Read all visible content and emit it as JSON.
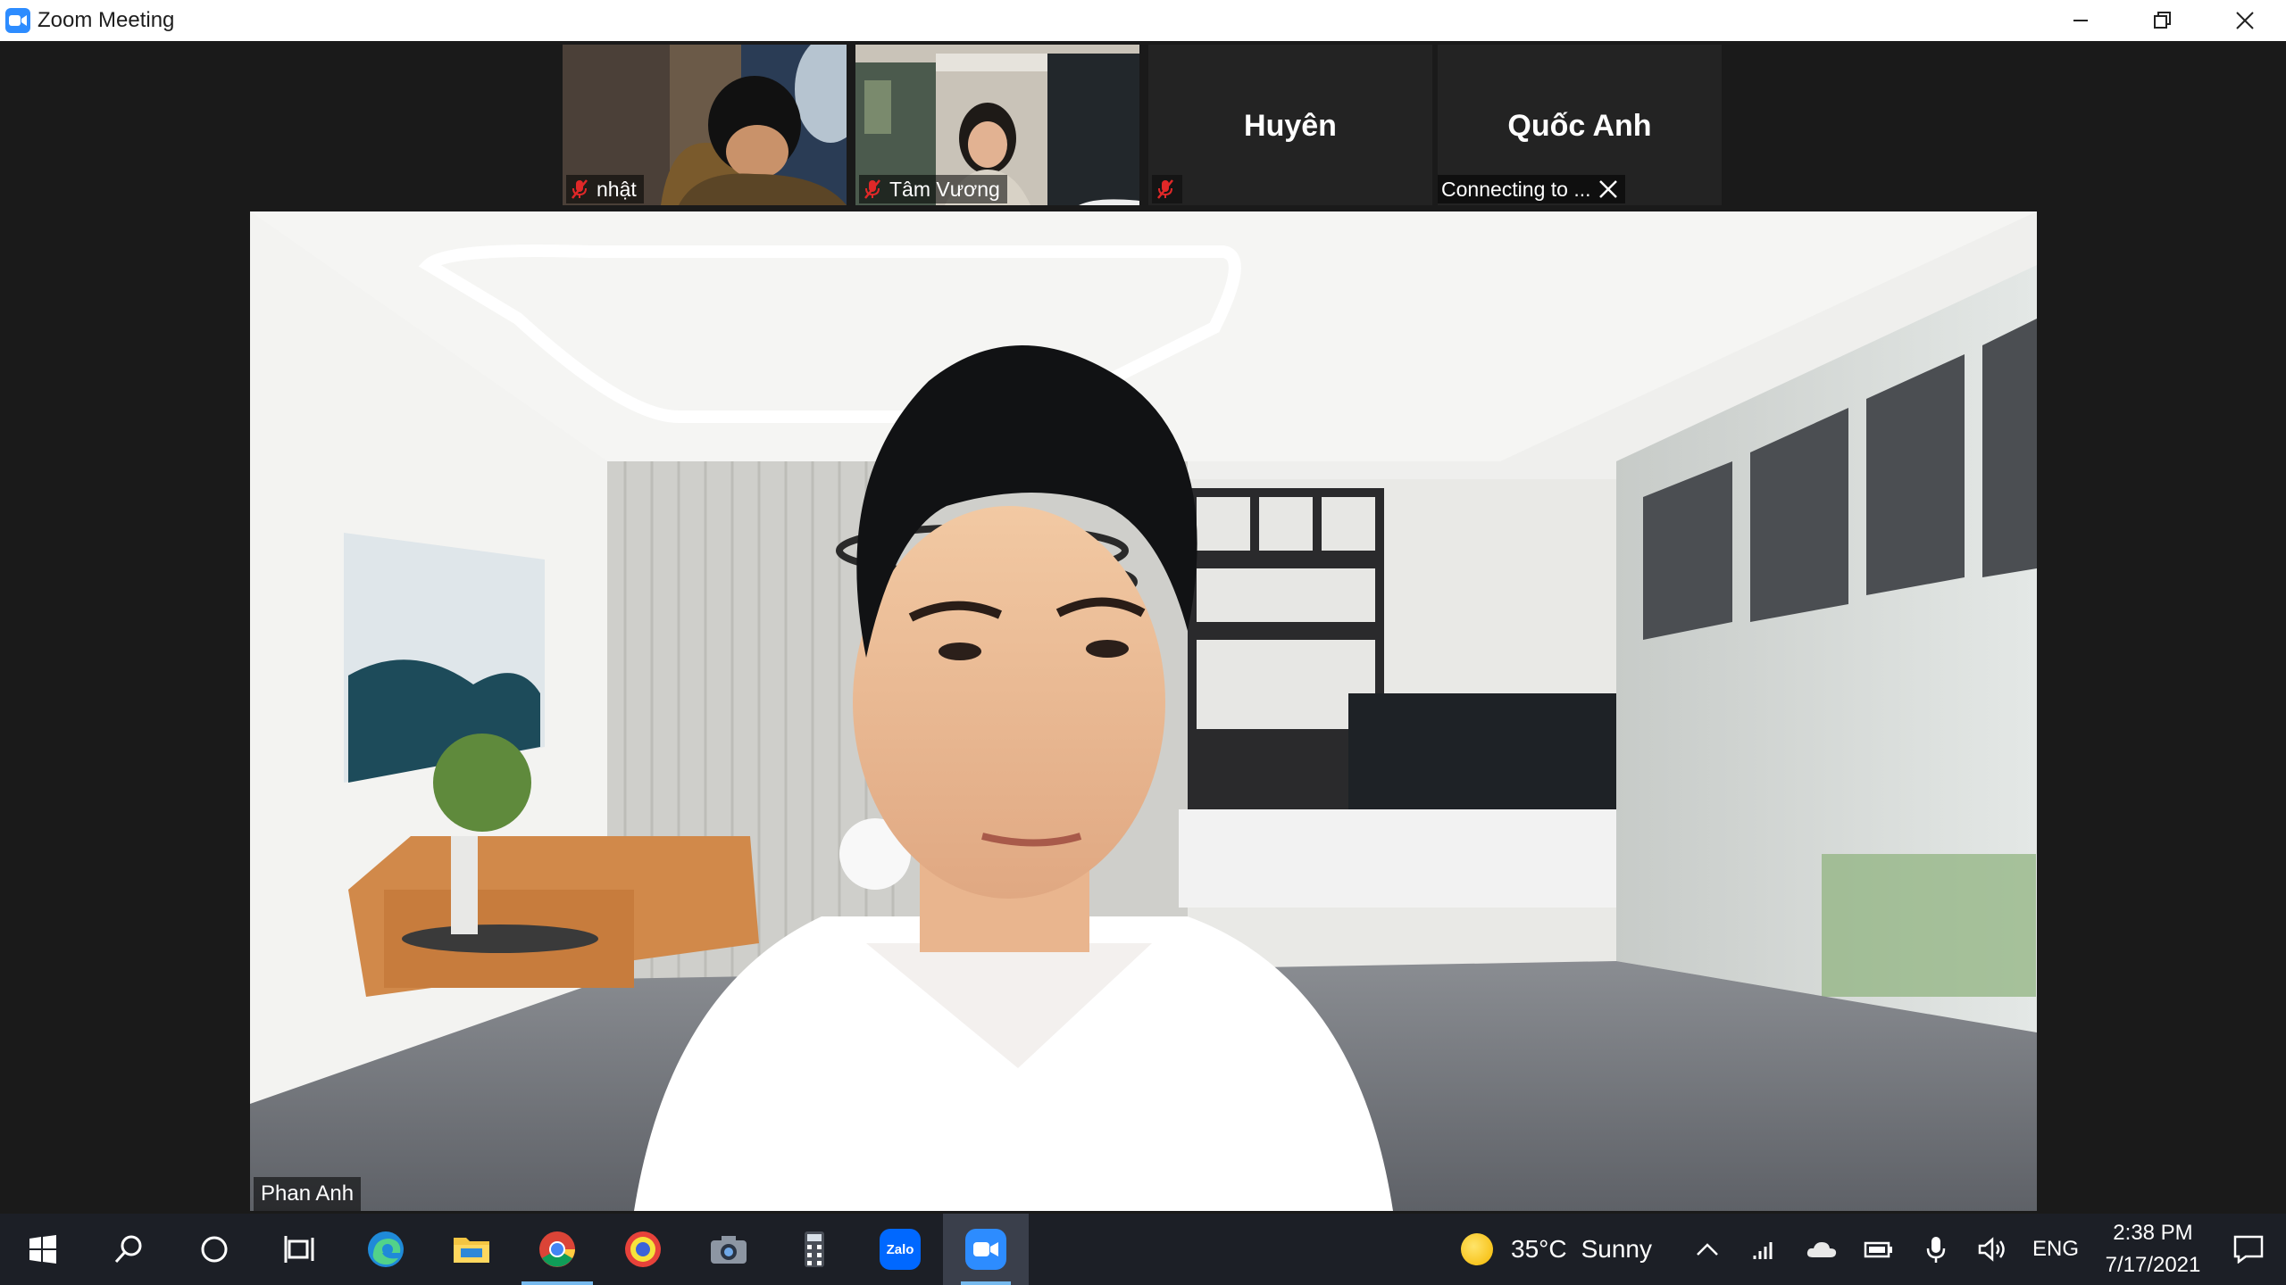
{
  "window": {
    "title": "Zoom Meeting",
    "controls": [
      "minimize-icon",
      "restore-icon",
      "close-icon"
    ]
  },
  "participants": [
    {
      "name": "nhật",
      "muted": true,
      "video": true
    },
    {
      "name": "Tâm Vương",
      "muted": true,
      "video": true
    },
    {
      "name": "Huyên",
      "muted": true,
      "video": false
    },
    {
      "name": "Quốc Anh",
      "status": "Connecting to ...",
      "video": false
    }
  ],
  "speaker": {
    "name": "Phan Anh"
  },
  "taskbar": {
    "apps": [
      "windows-start-icon",
      "search-icon",
      "cortana-icon",
      "task-view-icon",
      "edge-icon",
      "file-explorer-icon",
      "chrome-icon",
      "unikey-icon",
      "camera-icon",
      "calculator-icon",
      "zalo-icon",
      "zoom-icon"
    ],
    "zalo_label": "Zalo",
    "weather": {
      "temp": "35°C",
      "condition": "Sunny"
    },
    "language": "ENG",
    "time": "2:38 PM",
    "date": "7/17/2021",
    "accent": "#76b9ed"
  },
  "colors": {
    "zoom_blue": "#2d8cff",
    "mute_red": "#e02828"
  }
}
